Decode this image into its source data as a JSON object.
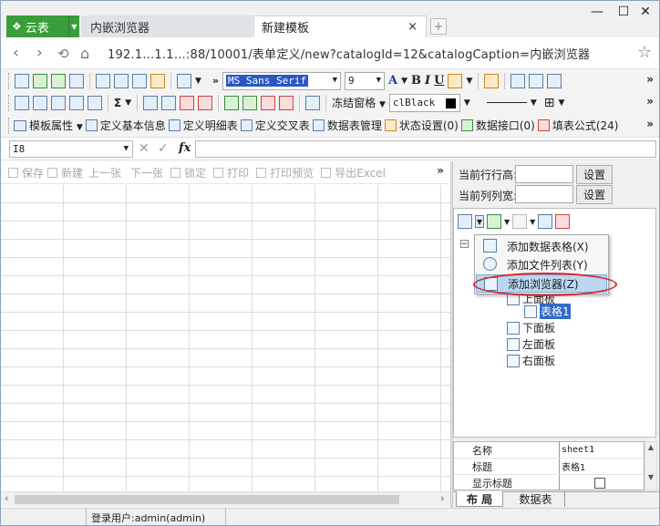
{
  "browser": {
    "app_label": "云表",
    "tabs": [
      {
        "label": "内嵌浏览器"
      },
      {
        "label": "新建模板"
      }
    ],
    "close_tab_glyph": "×",
    "url": "192.1…1.1…:88/10001/表单定义/new?catalogId=12&catalogCaption=内嵌浏览器"
  },
  "toolbar1": {
    "font_name": "MS Sans Serif",
    "font_size": "9",
    "bold": "B",
    "italic": "I",
    "underline": "U"
  },
  "toolbar2": {
    "sum_label": "Σ",
    "freeze_label": "冻结窗格",
    "color_value": "clBlack"
  },
  "toolbar3": {
    "items": [
      "模板属性",
      "定义基本信息",
      "定义明细表",
      "定义交叉表",
      "数据表管理",
      "状态设置(0)",
      "数据接口(0)",
      "填表公式(24)"
    ]
  },
  "formula_bar": {
    "cell_ref": "I8",
    "fx": "fx",
    "cancel": "✕",
    "confirm": "✓"
  },
  "sheet_toolbar": {
    "items": [
      "保存",
      "新建",
      "上一张",
      "下一张",
      "锁定",
      "打印",
      "打印预览",
      "导出Excel"
    ]
  },
  "right_panel": {
    "row_height_label": "当前行行高:",
    "col_width_label": "当前列列宽:",
    "set_button": "设置"
  },
  "context_menu": {
    "items": [
      {
        "label": "添加数据表格(X)"
      },
      {
        "label": "添加文件列表(Y)"
      },
      {
        "label": "添加浏览器(Z)"
      }
    ]
  },
  "tree": {
    "nodes": [
      {
        "label": "上面板"
      },
      {
        "label": "表格1"
      },
      {
        "label": "下面板"
      },
      {
        "label": "左面板"
      },
      {
        "label": "右面板"
      }
    ]
  },
  "properties": {
    "rows": [
      {
        "key": "名称",
        "value": "sheet1"
      },
      {
        "key": "标题",
        "value": "表格1"
      },
      {
        "key": "显示标题",
        "value": ""
      }
    ]
  },
  "bottom_tabs": {
    "layout": "布 局",
    "datatable": "数据表"
  },
  "status_bar": {
    "user": "登录用户:admin(admin)"
  },
  "colors": {
    "app_green": "#3a9d3a",
    "selection_blue": "#316ac5",
    "highlight_oval": "#d8242c"
  }
}
